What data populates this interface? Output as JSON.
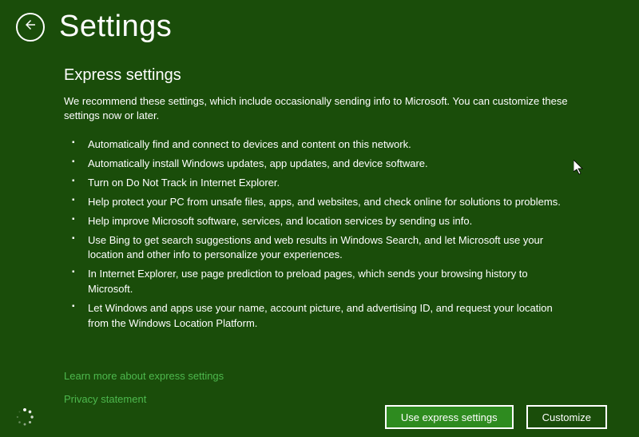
{
  "header": {
    "title": "Settings"
  },
  "main": {
    "subtitle": "Express settings",
    "intro": "We recommend these settings, which include occasionally sending info to Microsoft. You can customize these settings now or later.",
    "items": [
      "Automatically find and connect to devices and content on this network.",
      "Automatically install Windows updates, app updates, and device software.",
      "Turn on Do Not Track in Internet Explorer.",
      "Help protect your PC from unsafe files, apps, and websites, and check online for solutions to problems.",
      "Help improve Microsoft software, services, and location services by sending us info.",
      "Use Bing to get search suggestions and web results in Windows Search, and let Microsoft use your location and other info to personalize your experiences.",
      "In Internet Explorer, use page prediction to preload pages, which sends your browsing history to Microsoft.",
      "Let Windows and apps use your name, account picture, and advertising ID, and request your location from the Windows Location Platform."
    ]
  },
  "links": {
    "learn_more": "Learn more about express settings",
    "privacy": "Privacy statement"
  },
  "footer": {
    "primary_button": "Use express settings",
    "secondary_button": "Customize"
  }
}
